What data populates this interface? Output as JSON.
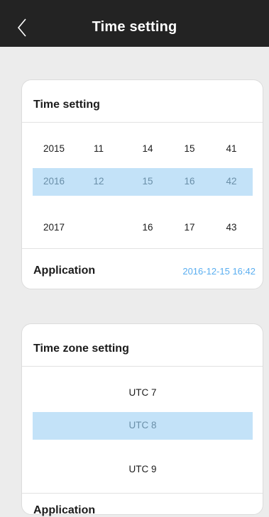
{
  "header": {
    "title": "Time setting",
    "back_icon": "chevron-left-icon"
  },
  "time_card": {
    "title": "Time setting",
    "rows": [
      [
        "2015",
        "11",
        "14",
        "15",
        "41"
      ],
      [
        "2016",
        "12",
        "15",
        "16",
        "42"
      ],
      [
        "2017",
        "",
        "16",
        "17",
        "43"
      ]
    ],
    "selected_row_index": 1,
    "apply_label": "Application",
    "apply_value": "2016-12-15 16:42"
  },
  "timezone_card": {
    "title": "Time zone setting",
    "rows": [
      "UTC 7",
      "UTC 8",
      "UTC 9"
    ],
    "selected_row_index": 1,
    "apply_label": "Application"
  },
  "colors": {
    "header_bg": "#232323",
    "selected_row_bg": "#c3e2f8",
    "accent_text": "#5aaef0",
    "page_bg": "#ececec"
  }
}
